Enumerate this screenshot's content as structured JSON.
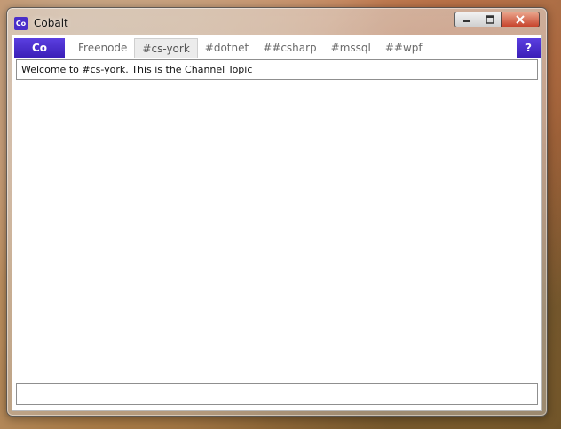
{
  "window": {
    "title": "Cobalt",
    "icon_label": "Co",
    "caption_icons": [
      "minimize-icon",
      "maximize-icon",
      "close-icon"
    ]
  },
  "toolbar": {
    "co_label": "Co",
    "help_label": "?"
  },
  "tabs": [
    {
      "label": "Freenode"
    },
    {
      "label": "#cs-york",
      "active": true
    },
    {
      "label": "#dotnet"
    },
    {
      "label": "##csharp"
    },
    {
      "label": "#mssql"
    },
    {
      "label": "##wpf"
    }
  ],
  "topic": "Welcome to #cs-york. This is the Channel Topic",
  "input": {
    "value": ""
  },
  "colors": {
    "accent": "#4a2fc9",
    "close_button": "#c7432b",
    "tab_text": "#6a6a6a"
  }
}
